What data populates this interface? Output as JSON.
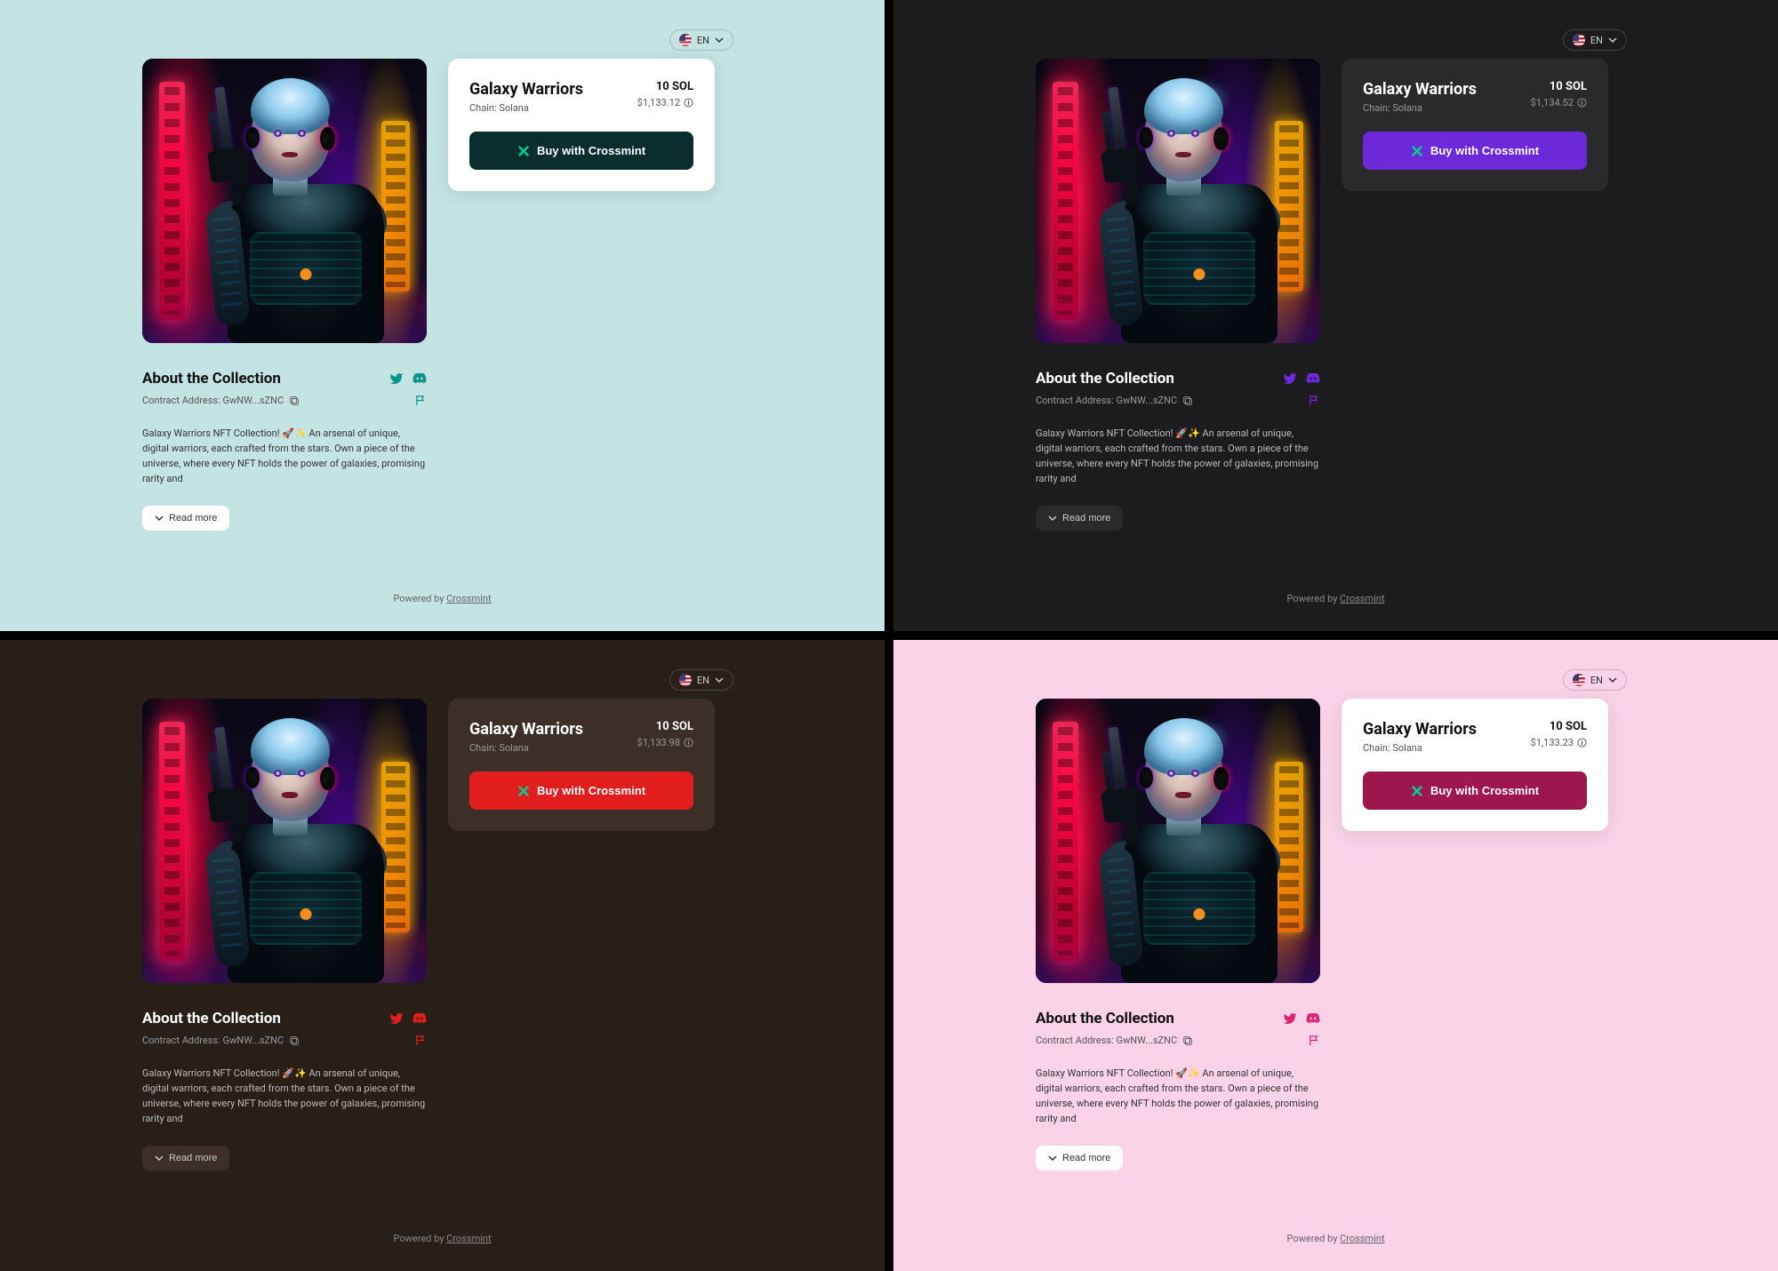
{
  "lang": {
    "code": "EN"
  },
  "nft": {
    "title": "Galaxy Warriors",
    "chain_label": "Chain: Solana",
    "price_token": "10 SOL",
    "buy_label": "Buy with Crossmint"
  },
  "about": {
    "heading": "About the Collection",
    "addr_label": "Contract Address: GwNW...sZNC",
    "description": "Galaxy Warriors NFT Collection! 🚀✨ An arsenal of unique, digital warriors, each crafted from the stars. Own a piece of the universe, where every NFT holds the power of galaxies, promising rarity and",
    "readmore": "Read more"
  },
  "footer": {
    "prefix": "Powered by ",
    "link": "Crossmint"
  },
  "variants": {
    "q1": {
      "fiat": "$1,133.12"
    },
    "q2": {
      "fiat": "$1,134.52"
    },
    "q3": {
      "fiat": "$1,133.98"
    },
    "q4": {
      "fiat": "$1,133.23"
    }
  }
}
